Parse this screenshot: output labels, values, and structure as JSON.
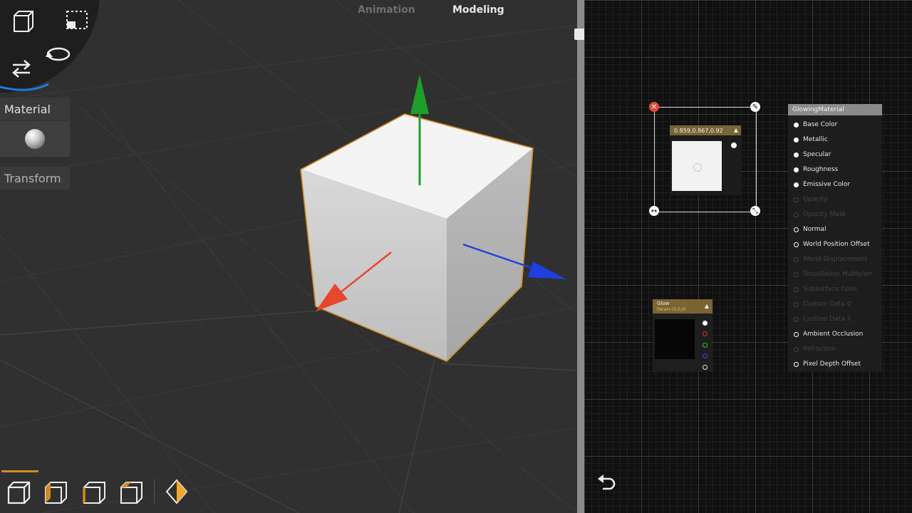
{
  "mode_tabs": {
    "animation": "Animation",
    "modeling": "Modeling"
  },
  "side_panel": {
    "material_label": "Material",
    "transform_label": "Transform"
  },
  "tools": [
    "object-mode",
    "box-select",
    "move",
    "rotate"
  ],
  "bottom_tools": [
    "object-select",
    "vertex-select",
    "edge-select",
    "face-select",
    "keyframe"
  ],
  "color_node": {
    "value": "0.859,0.867,0.92"
  },
  "glow_node": {
    "title": "Glow",
    "subtitle": "Param (0,0,0)"
  },
  "material_node": {
    "title": "GlowingMaterial",
    "pins": [
      {
        "label": "Base Color",
        "state": "connected"
      },
      {
        "label": "Metallic",
        "state": "connected"
      },
      {
        "label": "Specular",
        "state": "connected"
      },
      {
        "label": "Roughness",
        "state": "connected"
      },
      {
        "label": "Emissive Color",
        "state": "connected"
      },
      {
        "label": "Opacity",
        "state": "disabled"
      },
      {
        "label": "Opacity Mask",
        "state": "disabled"
      },
      {
        "label": "Normal",
        "state": "open"
      },
      {
        "label": "World Position Offset",
        "state": "open"
      },
      {
        "label": "World Displacement",
        "state": "disabled"
      },
      {
        "label": "Tessellation Multiplier",
        "state": "disabled"
      },
      {
        "label": "Subsurface Color",
        "state": "disabled"
      },
      {
        "label": "Custom Data 0",
        "state": "disabled"
      },
      {
        "label": "Custom Data 1",
        "state": "disabled"
      },
      {
        "label": "Ambient Occlusion",
        "state": "open"
      },
      {
        "label": "Refraction",
        "state": "disabled"
      },
      {
        "label": "Pixel Depth Offset",
        "state": "open"
      }
    ]
  },
  "colors": {
    "accent": "#d28b22",
    "gizmo_x": "#e8452f",
    "gizmo_y": "#1fa02a",
    "gizmo_z": "#1f3fe0",
    "node_header": "#786535"
  }
}
